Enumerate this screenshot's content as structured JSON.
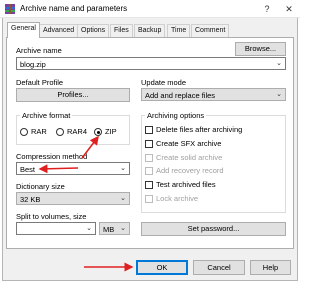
{
  "window": {
    "title": "Archive name and parameters",
    "help_glyph": "?",
    "close_glyph": "✕"
  },
  "tabs": [
    "General",
    "Advanced",
    "Options",
    "Files",
    "Backup",
    "Time",
    "Comment"
  ],
  "archive_name": {
    "label": "Archive name",
    "value": "blog.zip",
    "browse_label": "Browse..."
  },
  "default_profile": {
    "label": "Default Profile",
    "button_label": "Profiles..."
  },
  "update_mode": {
    "label": "Update mode",
    "value": "Add and replace files"
  },
  "archive_format": {
    "label": "Archive format",
    "options": [
      "RAR",
      "RAR4",
      "ZIP"
    ],
    "selected": "ZIP"
  },
  "compression_method": {
    "label": "Compression method",
    "value": "Best"
  },
  "dictionary_size": {
    "label": "Dictionary size",
    "value": "32 KB"
  },
  "split_volumes": {
    "label": "Split to volumes, size",
    "value": "",
    "unit": "MB"
  },
  "archiving_options": {
    "label": "Archiving options",
    "items": [
      {
        "label": "Delete files after archiving",
        "enabled": true
      },
      {
        "label": "Create SFX archive",
        "enabled": true
      },
      {
        "label": "Create solid archive",
        "enabled": false
      },
      {
        "label": "Add recovery record",
        "enabled": false
      },
      {
        "label": "Test archived files",
        "enabled": true
      },
      {
        "label": "Lock archive",
        "enabled": false
      }
    ]
  },
  "set_password_label": "Set password...",
  "footer": {
    "ok": "OK",
    "cancel": "Cancel",
    "help": "Help"
  },
  "colors": {
    "annotation_arrow": "#e02020",
    "accent": "#0078d7"
  }
}
